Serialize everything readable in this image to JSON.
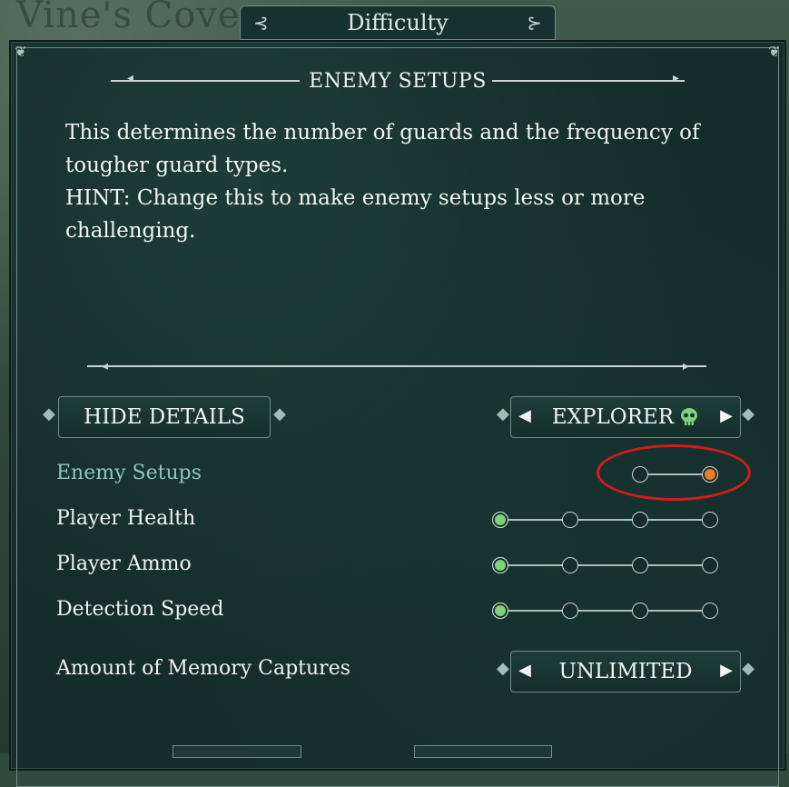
{
  "background": {
    "map_title": "Vine's Cove"
  },
  "window": {
    "tab_title": "Difficulty"
  },
  "section": {
    "title": "ENEMY SETUPS"
  },
  "description": {
    "line1": "This determines the number of guards and the frequency of",
    "line2": "tougher guard types.",
    "line3": "HINT: Change this to make enemy setups less or more",
    "line4": "challenging."
  },
  "buttons": {
    "hide_details": "HIDE DETAILS",
    "preset": "EXPLORER",
    "memory_value": "UNLIMITED"
  },
  "settings": [
    {
      "label": "Enemy Setups",
      "steps": 2,
      "selected": 2,
      "active": true,
      "color": "#e6812a"
    },
    {
      "label": "Player Health",
      "steps": 4,
      "selected": 1,
      "active": false,
      "color": "#7ed37a"
    },
    {
      "label": "Player Ammo",
      "steps": 4,
      "selected": 1,
      "active": false,
      "color": "#7ed37a"
    },
    {
      "label": "Detection Speed",
      "steps": 4,
      "selected": 1,
      "active": false,
      "color": "#7ed37a"
    }
  ],
  "memory_captures": {
    "label": "Amount of Memory Captures"
  },
  "colors": {
    "panel": "#142c2a",
    "accent_green": "#7ed37a",
    "accent_orange": "#e6812a",
    "highlight_ring": "#d41c1c"
  },
  "icons": {
    "preset_icon": "skull-icon",
    "left": "arrow-left-icon",
    "right": "arrow-right-icon"
  }
}
